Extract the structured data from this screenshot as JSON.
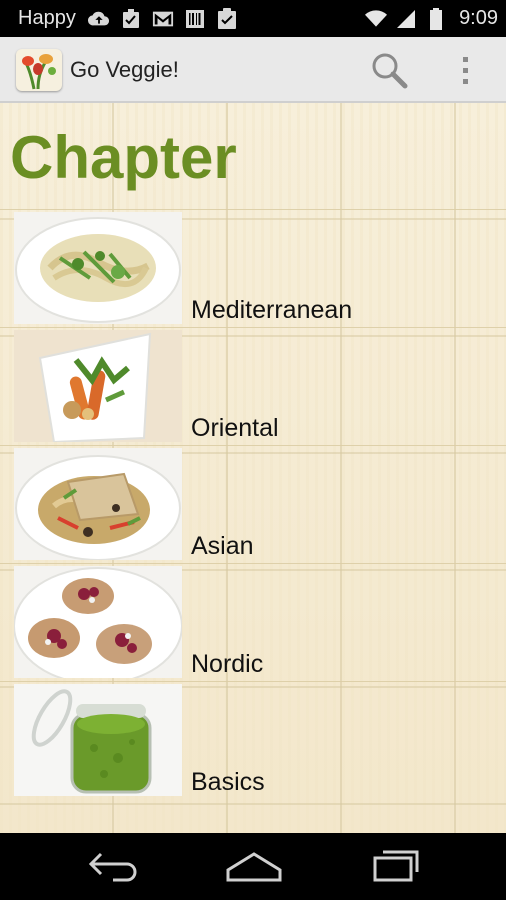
{
  "status_bar": {
    "carrier": "Happy",
    "time": "9:09",
    "left_icons": [
      "cloud-upload-icon",
      "checkbox-icon",
      "gmail-icon",
      "barcode-icon",
      "clipboard-check-icon"
    ],
    "right_icons": [
      "wifi-icon",
      "signal-icon",
      "battery-icon"
    ]
  },
  "action_bar": {
    "title": "Go Veggie!",
    "icons": [
      "app-logo-icon",
      "search-icon",
      "overflow-menu-icon"
    ],
    "background": "#e9e9e9"
  },
  "page": {
    "heading": "Chapter",
    "heading_color": "#6b8e23"
  },
  "chapters": [
    {
      "label": "Mediterranean",
      "image": "pasta-with-greens-dish"
    },
    {
      "label": "Oriental",
      "image": "carrot-and-herbs-dish"
    },
    {
      "label": "Asian",
      "image": "noodles-with-flatbread-dish"
    },
    {
      "label": "Nordic",
      "image": "beetroot-pancakes-dish"
    },
    {
      "label": "Basics",
      "image": "pesto-jar"
    }
  ],
  "nav_bar": {
    "icons": [
      "back-icon",
      "home-icon",
      "recent-apps-icon"
    ]
  }
}
